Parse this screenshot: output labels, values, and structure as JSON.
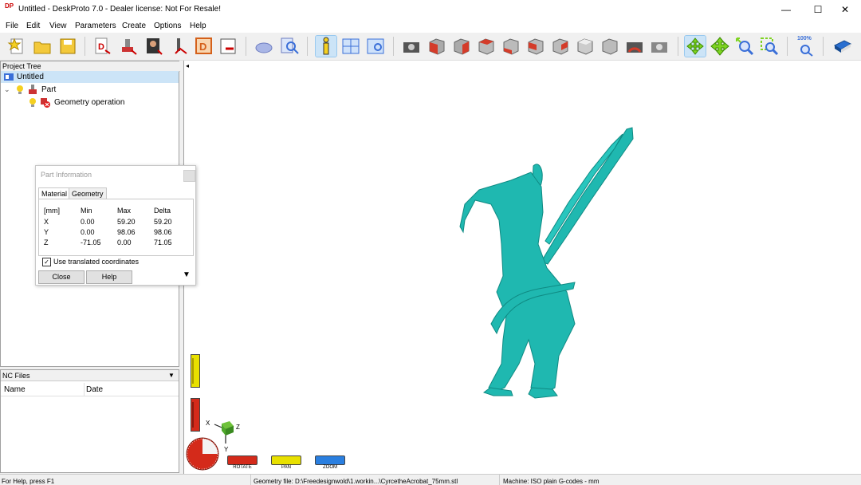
{
  "window": {
    "title": "Untitled - DeskProto 7.0 - Dealer license: Not For Resale!",
    "app_icon_text": "DP",
    "minimize": "—",
    "maximize": "☐",
    "close": "✕"
  },
  "menu": [
    "File",
    "Edit",
    "View",
    "Parameters",
    "Create",
    "Options",
    "Help"
  ],
  "toolbar": {
    "zoom_label": "100%",
    "icons": [
      "new-project-icon",
      "open-folder-icon",
      "save-icon",
      "dxf-icon",
      "part-icon",
      "geometry-icon",
      "drive-icon",
      "toolpath-icon",
      "save-nc-icon",
      "simulate-icon",
      "preview-icon",
      "info-icon",
      "layout-icon",
      "view-window-icon",
      "screenshot-icon",
      "view-front-icon",
      "view-back-icon",
      "view-left-icon",
      "view-right-icon",
      "view-top-icon",
      "view-bottom-icon",
      "view-iso-icon",
      "view-iso2-icon",
      "camera-reset-icon",
      "camera-settings-icon",
      "rotate-icon",
      "pan-icon",
      "zoom-icon",
      "zoom-window-icon",
      "zoom-100-icon",
      "book-icon"
    ]
  },
  "project_tree": {
    "header": "Project Tree",
    "items": [
      {
        "label": "Untitled"
      },
      {
        "label": "Part"
      },
      {
        "label": "Geometry operation"
      }
    ]
  },
  "nc_files": {
    "header": "NC Files",
    "columns": [
      "Name",
      "Date"
    ]
  },
  "part_info": {
    "title": "Part Information",
    "tabs": [
      "Material",
      "Geometry"
    ],
    "headers": [
      "[mm]",
      "Min",
      "Max",
      "Delta"
    ],
    "rows": [
      {
        "axis": "X",
        "min": "0.00",
        "max": "59.20",
        "delta": "59.20"
      },
      {
        "axis": "Y",
        "min": "0.00",
        "max": "98.06",
        "delta": "98.06"
      },
      {
        "axis": "Z",
        "min": "-71.05",
        "max": "0.00",
        "delta": "71.05"
      }
    ],
    "checkbox_label": "Use translated coordinates",
    "checkbox_checked": true,
    "close_label": "Close",
    "help_label": "Help"
  },
  "viewport": {
    "model_color": "#1fb8b0",
    "axis_x": "X",
    "axis_y": "Y",
    "axis_z": "Z",
    "legend": [
      "ROTATE",
      "PAN",
      "ZOOM"
    ],
    "legend_colors": [
      "#d42a1a",
      "#e8e000",
      "#2a7fe0"
    ]
  },
  "status": {
    "help": "For Help, press F1",
    "geometry": "Geometry file: D:\\Freedesignwold\\1.workin...\\CyrcetheAcrobat_75mm.stl",
    "machine": "Machine: ISO plain G-codes - mm"
  }
}
